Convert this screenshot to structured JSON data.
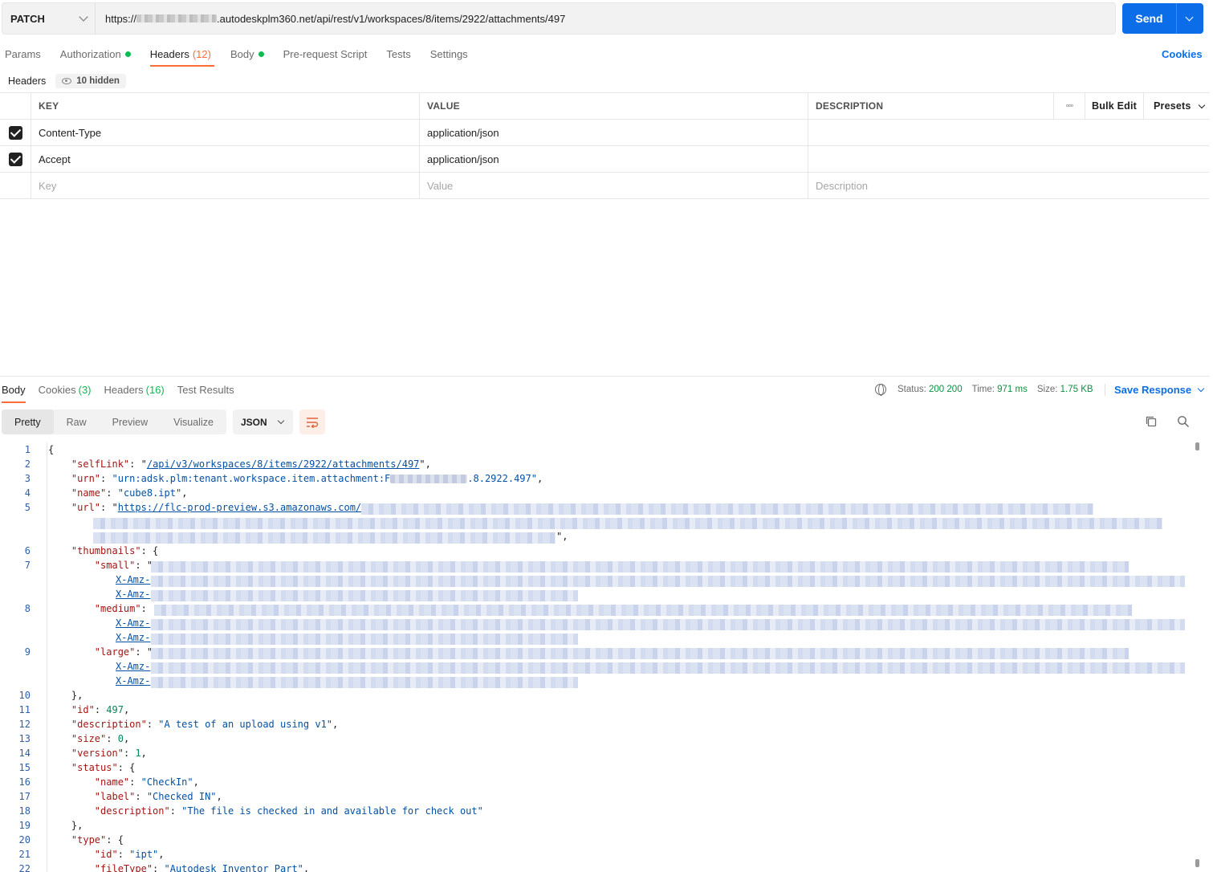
{
  "request": {
    "method": "PATCH",
    "url_prefix": "https://",
    "url_suffix": ".autodeskplm360.net/api/rest/v1/workspaces/8/items/2922/attachments/497",
    "send_label": "Send"
  },
  "tabs": [
    {
      "label": "Params"
    },
    {
      "label": "Authorization"
    },
    {
      "label": "Headers",
      "count": "(12)"
    },
    {
      "label": "Body"
    },
    {
      "label": "Pre-request Script"
    },
    {
      "label": "Tests"
    },
    {
      "label": "Settings"
    }
  ],
  "cookies_label": "Cookies",
  "headers_section": {
    "title": "Headers",
    "hidden": "10 hidden"
  },
  "headers_table": {
    "columns": {
      "key": "KEY",
      "value": "VALUE",
      "description": "DESCRIPTION",
      "bulk_edit": "Bulk Edit",
      "presets": "Presets"
    },
    "rows": [
      {
        "key": "Content-Type",
        "value": "application/json"
      },
      {
        "key": "Accept",
        "value": "application/json"
      }
    ],
    "placeholders": {
      "key": "Key",
      "value": "Value",
      "description": "Description"
    }
  },
  "response": {
    "tabs": [
      {
        "label": "Body"
      },
      {
        "label": "Cookies",
        "count": "(3)"
      },
      {
        "label": "Headers",
        "count": "(16)"
      },
      {
        "label": "Test Results"
      }
    ],
    "status_label": "Status:",
    "status_value": "200 200",
    "time_label": "Time:",
    "time_value": "971 ms",
    "size_label": "Size:",
    "size_value": "1.75 KB",
    "save_label": "Save Response",
    "view_modes": [
      "Pretty",
      "Raw",
      "Preview",
      "Visualize"
    ],
    "format": "JSON"
  },
  "code": {
    "line_numbers": [
      "1",
      "2",
      "3",
      "4",
      "5",
      "6",
      "7",
      "8",
      "9",
      "10",
      "11",
      "12",
      "13",
      "14",
      "15",
      "16",
      "17",
      "18",
      "19",
      "20",
      "21",
      "22"
    ],
    "self_link_key": "\"selfLink\"",
    "self_link_val": "/api/v3/workspaces/8/items/2922/attachments/497",
    "urn_key": "\"urn\"",
    "urn_val_a": "\"urn:adsk.plm:tenant.workspace.item.attachment:F",
    "urn_val_b": ".8.2922.497\"",
    "name_key": "\"name\"",
    "name_val": "\"cube8.ipt\"",
    "url_key": "\"url\"",
    "url_val": "https://flc-prod-preview.s3.amazonaws.com/",
    "thumbnails_key": "\"thumbnails\"",
    "small_key": "\"small\"",
    "medium_key": "\"medium\"",
    "large_key": "\"large\"",
    "amz": "X-Amz-",
    "id_key": "\"id\"",
    "id_val": "497",
    "description_key": "\"description\"",
    "description_val": "\"A test of an upload using v1\"",
    "size_key": "\"size\"",
    "size_val": "0",
    "version_key": "\"version\"",
    "version_val": "1",
    "status_key": "\"status\"",
    "status_name_key": "\"name\"",
    "status_name_val": "\"CheckIn\"",
    "status_label_key": "\"label\"",
    "status_label_val": "\"Checked IN\"",
    "status_desc_key": "\"description\"",
    "status_desc_val": "\"The file is checked in and available for check out\"",
    "type_key": "\"type\"",
    "type_id_key": "\"id\"",
    "type_id_val": "\"ipt\"",
    "file_type_key": "\"fileType\"",
    "file_type_val": "\"Autodesk Inventor Part\""
  }
}
